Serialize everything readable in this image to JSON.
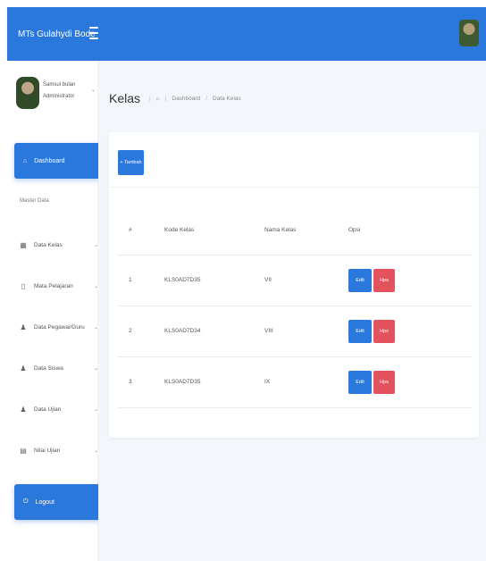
{
  "app": {
    "brand": "MTs Gulahydi Bode"
  },
  "user": {
    "name": "Samsul bulan",
    "role": "Administrator"
  },
  "sidebar": {
    "dashboard_label": "Dashboard",
    "section_label": "Master Data",
    "items": [
      {
        "label": "Data Kelas",
        "icon": "building-icon"
      },
      {
        "label": "Mata Pelajaran",
        "icon": "book-icon"
      },
      {
        "label": "Data Pegawai/Guru",
        "icon": "user-icon"
      },
      {
        "label": "Data Siswa",
        "icon": "user-icon"
      },
      {
        "label": "Data Ujian",
        "icon": "users-icon"
      },
      {
        "label": "Nilai Ujian",
        "icon": "file-icon"
      }
    ],
    "logout_label": "Logout"
  },
  "page": {
    "title": "Kelas",
    "breadcrumb": [
      "Dashboard",
      "Data Kelas"
    ]
  },
  "card": {
    "add_label": "+ Tambah",
    "columns": [
      "#",
      "Kode Kelas",
      "Nama Kelas",
      "Opsi"
    ],
    "rows": [
      {
        "no": "1",
        "kode": "KLS0AD7D35",
        "nama": "VII",
        "edit": "Edit",
        "del": "Hps"
      },
      {
        "no": "2",
        "kode": "KLS0AD7D34",
        "nama": "VIII",
        "edit": "Edit",
        "del": "Hps"
      },
      {
        "no": "3",
        "kode": "KLS0AD7D35",
        "nama": "IX",
        "edit": "Edit",
        "del": "Hps"
      }
    ]
  },
  "colors": {
    "primary": "#2b78dc",
    "danger": "#e3535d",
    "background": "#f3f7fc"
  }
}
